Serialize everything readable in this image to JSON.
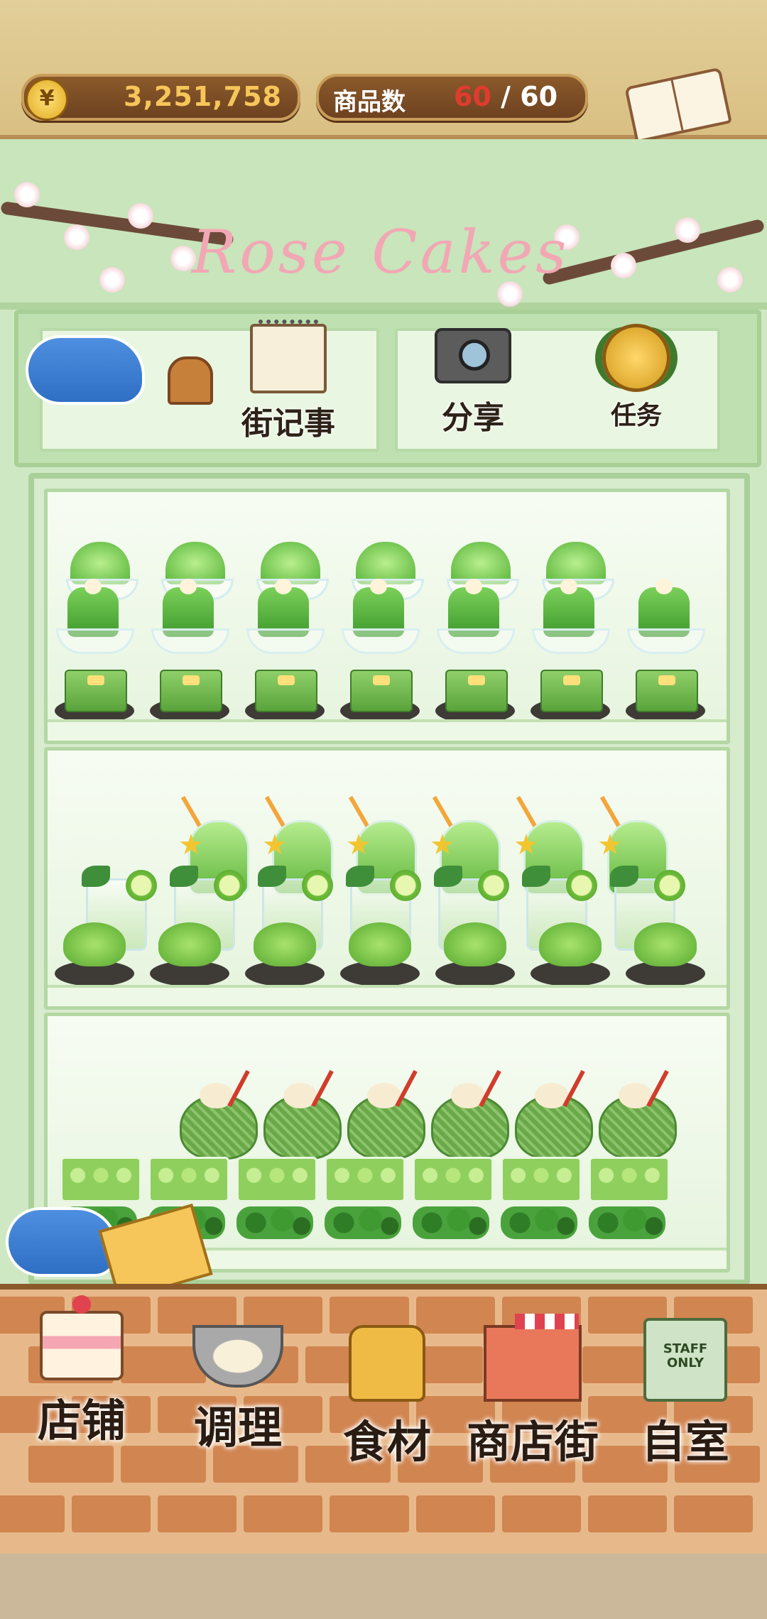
{
  "hud": {
    "coin_symbol": "¥",
    "money": "3,251,758",
    "item_count_label": "商品数",
    "item_count_current": "60",
    "item_count_separator": " / ",
    "item_count_max": "60"
  },
  "recipe_button": {
    "label": "食谱",
    "icon": "recipe-book-icon"
  },
  "shop_sign": {
    "text": "Rose Cakes"
  },
  "top_menu": {
    "news": {
      "label": "街记事",
      "icon": "notebook-icon"
    },
    "share": {
      "label": "分享",
      "icon": "camera-icon"
    },
    "tasks": {
      "label": "任务",
      "icon": "medal-icon"
    }
  },
  "shelves": [
    {
      "rows": [
        "shaved-ice",
        "green-jelly-pudding",
        "square-cake"
      ],
      "count_per_row": 7
    },
    {
      "rows": [
        "starfruit-drink",
        "lime-soda",
        "green-mound"
      ],
      "count_per_row": 7
    },
    {
      "rows": [
        "melon-drink",
        "grape-box",
        "leafy-greens"
      ],
      "count_per_row": 7
    }
  ],
  "bottom_nav": {
    "store": {
      "label": "店铺",
      "icon": "cake-icon"
    },
    "cook": {
      "label": "调理",
      "icon": "mixing-bowl-icon"
    },
    "ingredients": {
      "label": "食材",
      "icon": "flour-bag-icon"
    },
    "street": {
      "label": "商店街",
      "icon": "shop-icon"
    },
    "home": {
      "label": "自室",
      "icon": "staff-door-icon",
      "door_text": "STAFF ONLY"
    }
  },
  "colors": {
    "hud_bg": "#7a4a22",
    "money_text": "#f6c65a",
    "count_current": "#e03b2f",
    "shelf_green": "#cfe8c4",
    "brick": "#c9743c"
  }
}
